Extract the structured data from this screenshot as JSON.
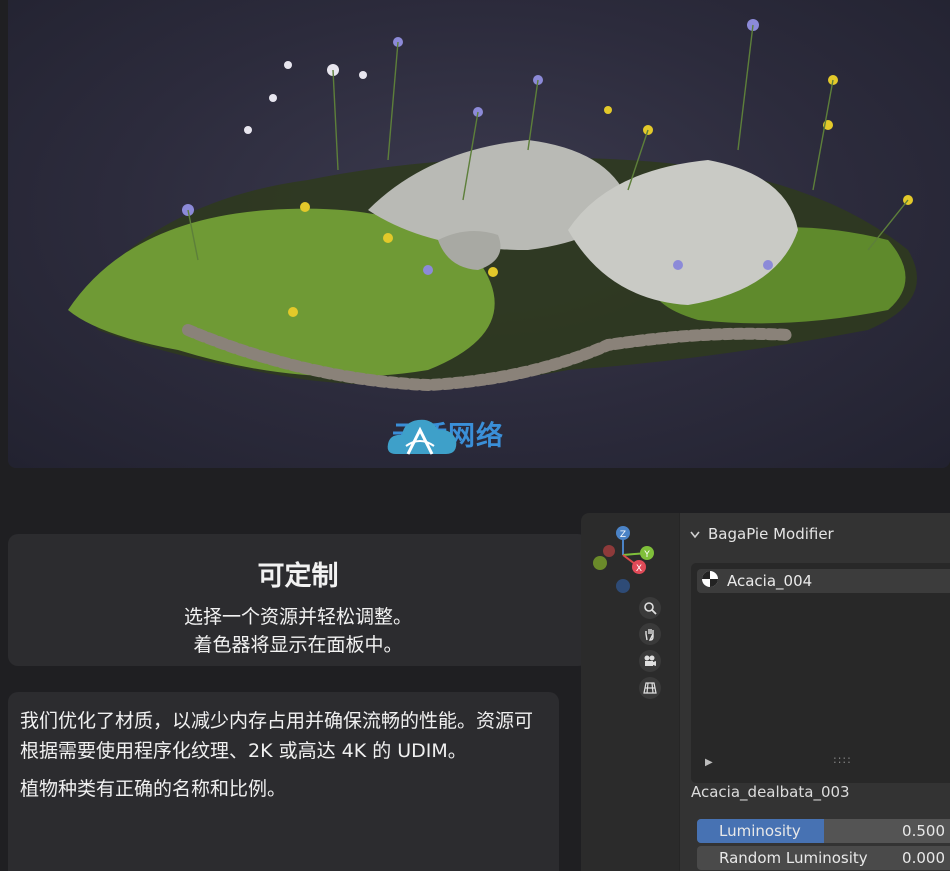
{
  "hero": {
    "watermark_text": "云桥网络",
    "logo_icon": "cloud-bridge-logo-icon"
  },
  "feature_card": {
    "title": "可定制",
    "line1": "选择一个资源并轻松调整。",
    "line2": "着色器将显示在面板中。"
  },
  "description_card": {
    "paragraph1": "我们优化了材质，以减少内存占用并确保流畅的性能。资源可根据需要使用程序化纹理、2K 或高达 4K 的 UDIM。",
    "paragraph2": "植物种类有正确的名称和比例。"
  },
  "viewport": {
    "gizmo_labels": {
      "z": "Z",
      "y": "Y",
      "x": "X"
    },
    "nav_icons": [
      "zoom-icon",
      "hand-pan-icon",
      "camera-icon",
      "grid-ortho-icon"
    ]
  },
  "properties_panel": {
    "header_label": "BagaPie Modifier",
    "list_item_label": "Acacia_004",
    "grip_glyph": "::::",
    "object_label": "Acacia_dealbata_003",
    "sliders": [
      {
        "label": "Luminosity",
        "value": "0.500",
        "fraction": 0.5
      },
      {
        "label": "Random Luminosity",
        "value": "0.000",
        "fraction": 0.0
      }
    ]
  },
  "colors": {
    "accent_blue": "#4772b3",
    "card_bg": "#2c2c2f",
    "watermark": "#3a8fd8"
  }
}
